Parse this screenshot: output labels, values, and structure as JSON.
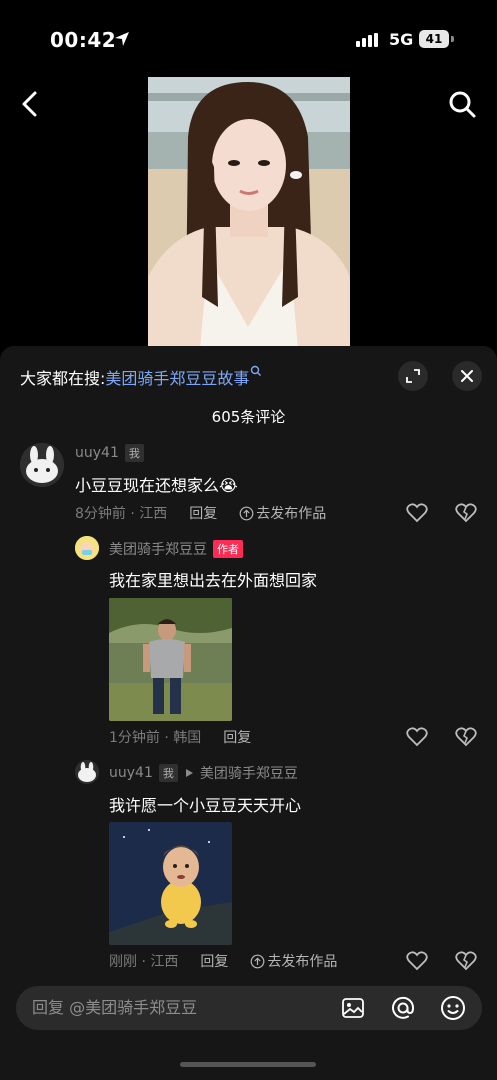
{
  "status_bar": {
    "time": "00:42",
    "network": "5G",
    "battery": "41"
  },
  "hot_search": {
    "prefix": "大家都在搜:",
    "query": "美团骑手郑豆豆故事"
  },
  "comments_count": "605条评论",
  "comments": [
    {
      "username": "uuy41",
      "tag": "我",
      "text": "小豆豆现在还想家么😭",
      "meta": "8分钟前 · 江西",
      "reply_label": "回复",
      "post_label": "去发布作品"
    },
    {
      "username": "美团骑手郑豆豆",
      "tag": "作者",
      "text": "我在家里想出去在外面想回家",
      "meta": "1分钟前 · 韩国",
      "reply_label": "回复"
    },
    {
      "username": "uuy41",
      "tag": "我",
      "reply_to": "美团骑手郑豆豆",
      "text": "我许愿一个小豆豆天天开心",
      "meta": "刚刚 · 江西",
      "reply_label": "回复",
      "post_label": "去发布作品"
    }
  ],
  "input": {
    "placeholder": "回复 @美团骑手郑豆豆"
  },
  "colors": {
    "sheet_bg": "#161616",
    "link_blue": "#7fa7f3",
    "author_tag": "#fe2c55"
  }
}
